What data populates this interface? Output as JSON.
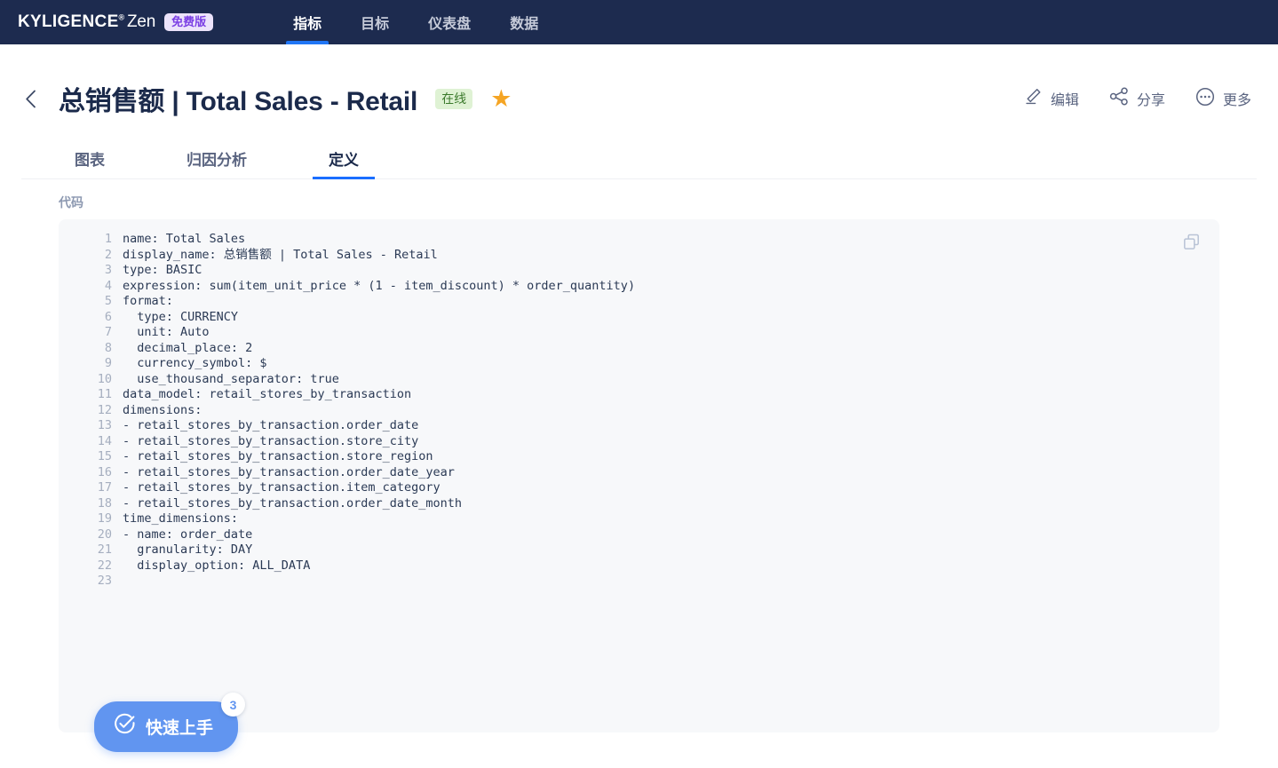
{
  "topnav": {
    "brand": {
      "name_bold": "KYLIGENCE",
      "registered": "®",
      "name_light": "Zen"
    },
    "plan_badge": "免费版",
    "links": [
      {
        "label": "指标",
        "active": true
      },
      {
        "label": "目标",
        "active": false
      },
      {
        "label": "仪表盘",
        "active": false
      },
      {
        "label": "数据",
        "active": false
      }
    ]
  },
  "header": {
    "back_icon": "chevron-left-icon",
    "title": "总销售额 | Total Sales - Retail",
    "status": "在线",
    "star": "★",
    "actions": [
      {
        "icon": "pencil-icon",
        "label": "编辑"
      },
      {
        "icon": "share-icon",
        "label": "分享"
      },
      {
        "icon": "ellipsis-circle-icon",
        "label": "更多"
      }
    ]
  },
  "tabs": [
    {
      "label": "图表",
      "active": false
    },
    {
      "label": "归因分析",
      "active": false
    },
    {
      "label": "定义",
      "active": true
    }
  ],
  "code_section": {
    "label": "代码",
    "copy_icon": "copy-icon",
    "lines": [
      {
        "n": "1",
        "text": "name: Total Sales"
      },
      {
        "n": "2",
        "text": "display_name: 总销售额 | Total Sales - Retail"
      },
      {
        "n": "3",
        "text": "type: BASIC"
      },
      {
        "n": "4",
        "text": "expression: sum(item_unit_price * (1 - item_discount) * order_quantity)"
      },
      {
        "n": "5",
        "text": "format:"
      },
      {
        "n": "6",
        "text": "  type: CURRENCY"
      },
      {
        "n": "7",
        "text": "  unit: Auto"
      },
      {
        "n": "8",
        "text": "  decimal_place: 2"
      },
      {
        "n": "9",
        "text": "  currency_symbol: $"
      },
      {
        "n": "10",
        "text": "  use_thousand_separator: true"
      },
      {
        "n": "11",
        "text": "data_model: retail_stores_by_transaction"
      },
      {
        "n": "12",
        "text": "dimensions:"
      },
      {
        "n": "13",
        "text": "- retail_stores_by_transaction.order_date"
      },
      {
        "n": "14",
        "text": "- retail_stores_by_transaction.store_city"
      },
      {
        "n": "15",
        "text": "- retail_stores_by_transaction.store_region"
      },
      {
        "n": "16",
        "text": "- retail_stores_by_transaction.order_date_year"
      },
      {
        "n": "17",
        "text": "- retail_stores_by_transaction.item_category"
      },
      {
        "n": "18",
        "text": "- retail_stores_by_transaction.order_date_month"
      },
      {
        "n": "19",
        "text": "time_dimensions:"
      },
      {
        "n": "20",
        "text": "- name: order_date"
      },
      {
        "n": "21",
        "text": "  granularity: DAY"
      },
      {
        "n": "22",
        "text": "  display_option: ALL_DATA"
      },
      {
        "n": "23",
        "text": ""
      }
    ]
  },
  "guide_fab": {
    "icon": "check-circle-icon",
    "label": "快速上手",
    "badge": "3"
  },
  "colors": {
    "nav_bg": "#1d2b4f",
    "accent_blue": "#1a6eff",
    "fab_blue": "#6195f0",
    "status_green_bg": "#dff2d4",
    "status_green_text": "#3b7a2c",
    "plan_badge_bg": "#ece3fb",
    "plan_badge_text": "#7b3fe4",
    "star_orange": "#f5a524",
    "code_bg": "#f7f8fa"
  }
}
